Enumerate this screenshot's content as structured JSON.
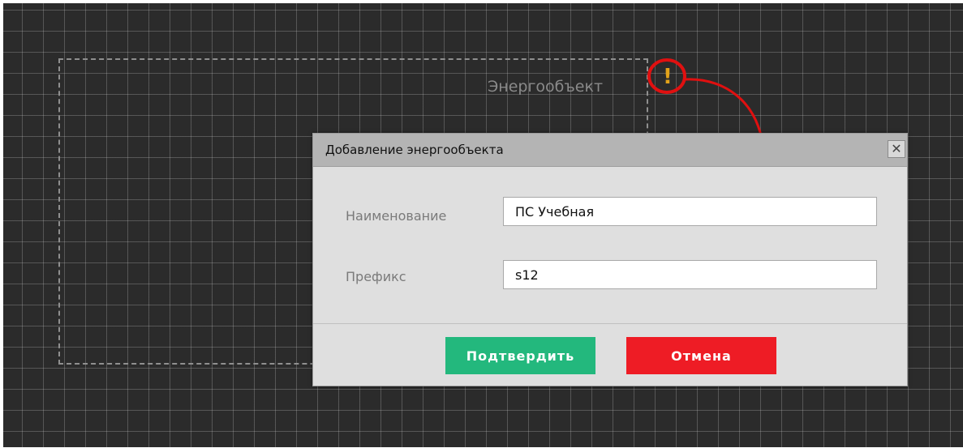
{
  "canvas": {
    "object_label": "Энергообъект",
    "warning_icon": "exclamation-icon",
    "warning_glyph": "!",
    "colors": {
      "background": "#2b2b2b",
      "grid": "#5a5a5a",
      "warning": "#e2a21a",
      "annotation": "#e01010"
    }
  },
  "dialog": {
    "title": "Добавление энергообъекта",
    "close_glyph": "✕",
    "fields": {
      "name": {
        "label": "Наименование",
        "value": "ПС Учебная"
      },
      "prefix": {
        "label": "Префикс",
        "value": "s12"
      }
    },
    "buttons": {
      "confirm": "Подтвердить",
      "cancel": "Отмена"
    },
    "colors": {
      "confirm": "#23b87d",
      "cancel": "#ee1c25",
      "header": "#b4b4b4",
      "body": "#dfdfdf"
    }
  }
}
